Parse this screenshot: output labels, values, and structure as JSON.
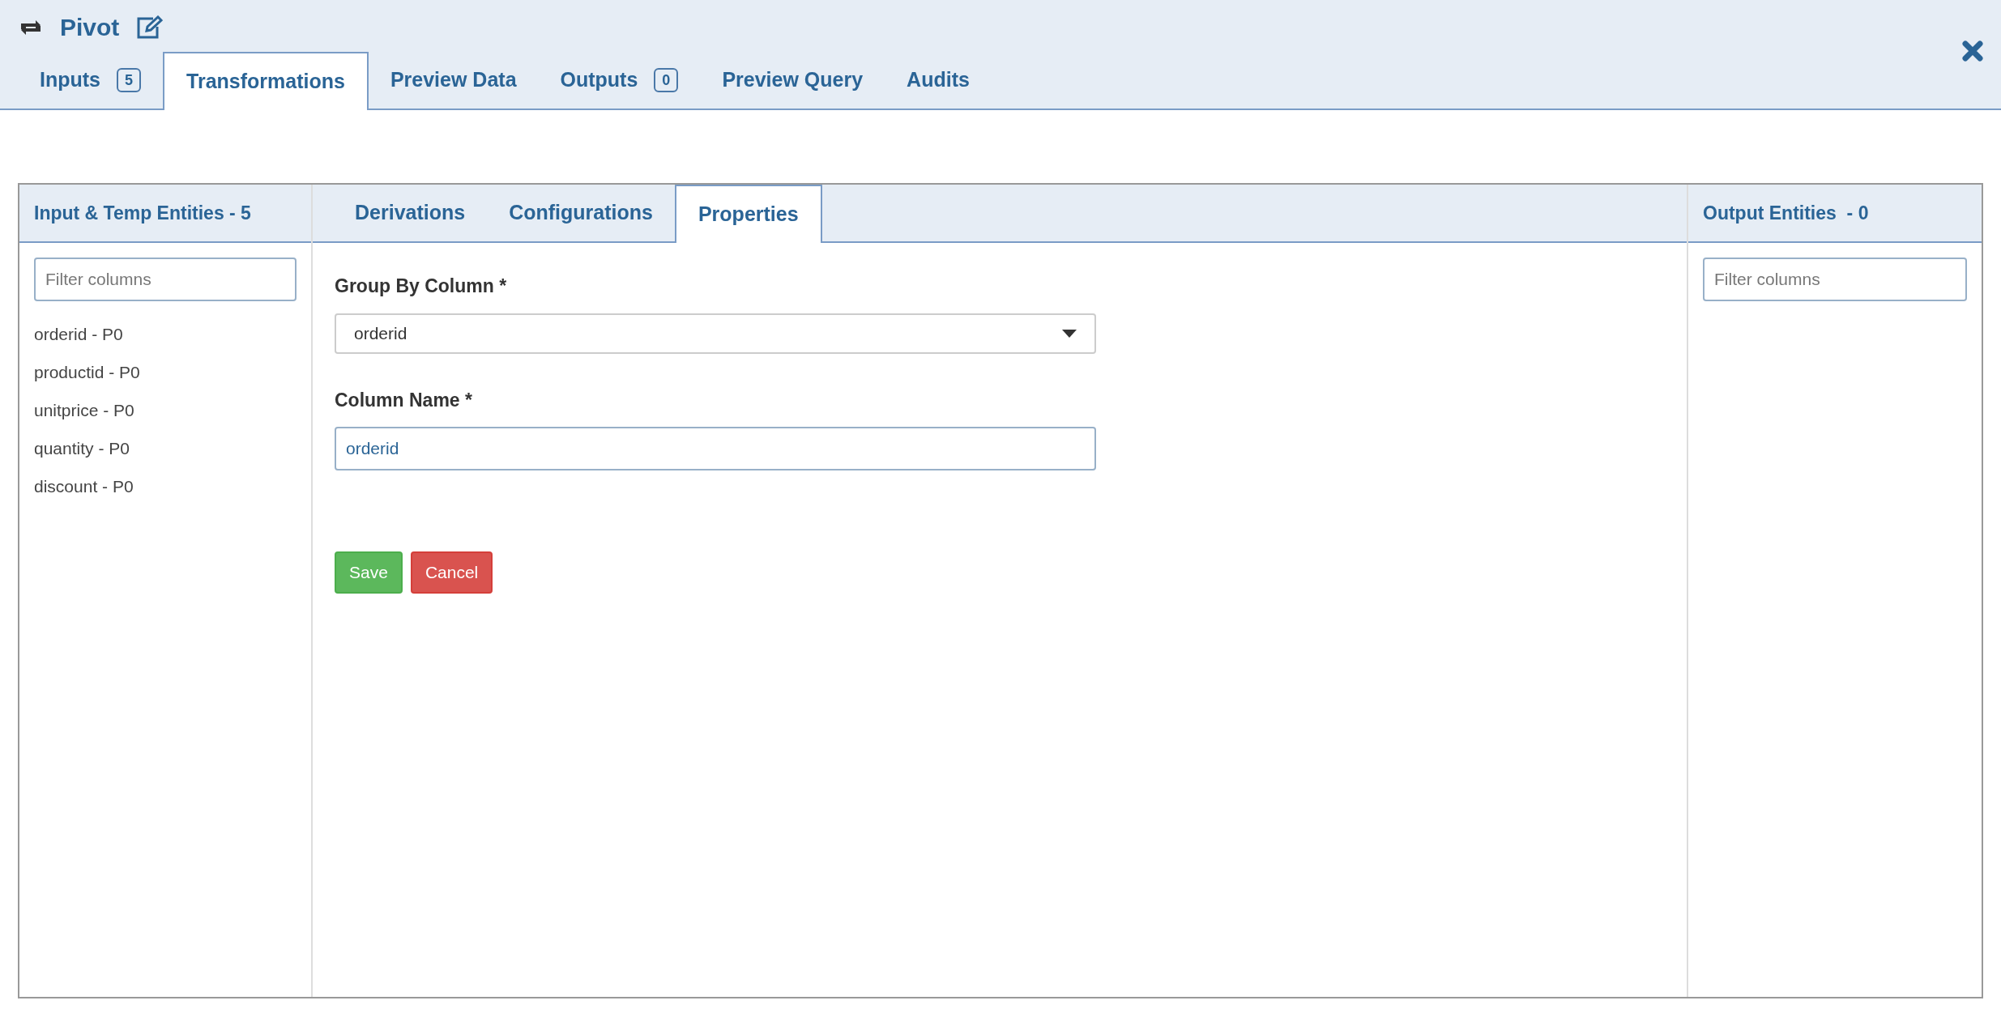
{
  "header": {
    "title": "Pivot"
  },
  "tabs": [
    {
      "label": "Inputs",
      "badge": "5",
      "selected": false
    },
    {
      "label": "Transformations",
      "selected": true
    },
    {
      "label": "Preview Data",
      "selected": false
    },
    {
      "label": "Outputs",
      "badge": "0",
      "selected": false
    },
    {
      "label": "Preview Query",
      "selected": false
    },
    {
      "label": "Audits",
      "selected": false
    }
  ],
  "left_panel": {
    "title": "Input & Temp Entities - 5",
    "filter": {
      "placeholder": "Filter columns"
    },
    "items": [
      "orderid - P0",
      "productid - P0",
      "unitprice - P0",
      "quantity - P0",
      "discount - P0"
    ]
  },
  "center_tabs": [
    {
      "label": "Derivations",
      "selected": false
    },
    {
      "label": "Configurations",
      "selected": false
    },
    {
      "label": "Properties",
      "selected": true
    }
  ],
  "form": {
    "group_by_label": "Group By Column *",
    "group_by_value": "orderid",
    "column_name_label": "Column Name *",
    "column_name_value": "orderid"
  },
  "buttons": [
    {
      "label": "Save",
      "kind": "success"
    },
    {
      "label": "Cancel",
      "kind": "danger"
    }
  ],
  "right_panel": {
    "title": "Output Entities  - 0",
    "filter": {
      "placeholder": "Filter columns"
    }
  }
}
